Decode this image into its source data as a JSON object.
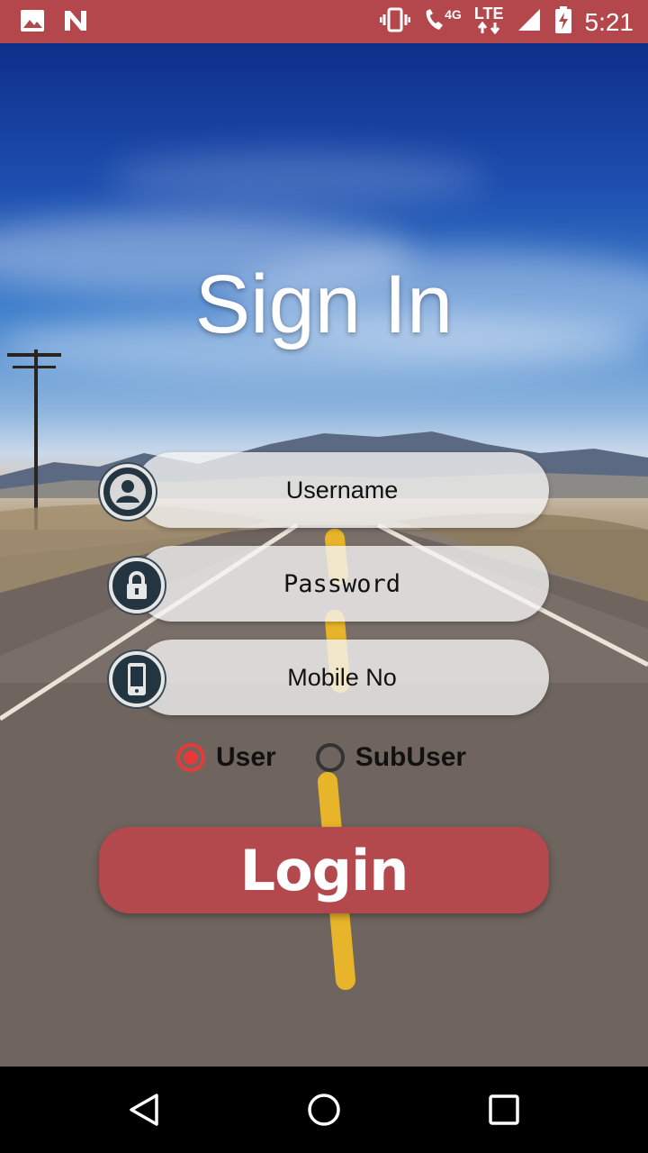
{
  "status_bar": {
    "network": "4G",
    "lte": "LTE",
    "time": "5:21"
  },
  "page": {
    "title": "Sign In"
  },
  "form": {
    "username_placeholder": "Username",
    "password_placeholder": "Password",
    "mobile_placeholder": "Mobile No",
    "role_options": [
      {
        "label": "User",
        "selected": true
      },
      {
        "label": "SubUser",
        "selected": false
      }
    ],
    "login_label": "Login"
  },
  "colors": {
    "accent": "#b3484d",
    "radio_selected": "#e53a3a"
  },
  "nav_bar": {
    "icons": [
      "back-icon",
      "home-icon",
      "recents-icon"
    ]
  }
}
